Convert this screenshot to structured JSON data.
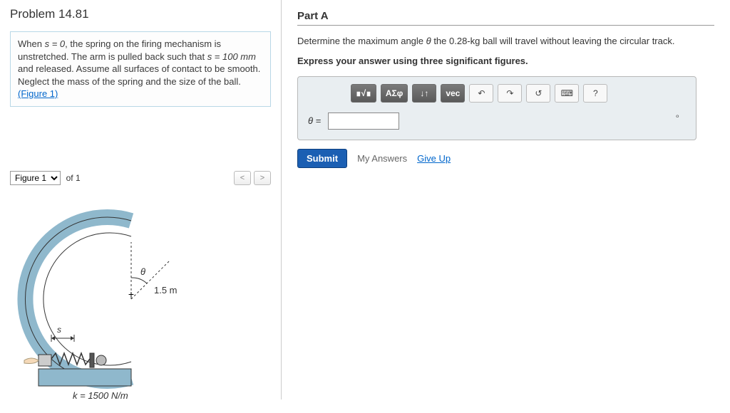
{
  "problem": {
    "number": "Problem 14.81",
    "statement_prefix": "When ",
    "statement_s0": "s = 0",
    "statement_mid1": ", the spring on the firing mechanism is unstretched. The arm is pulled back such that ",
    "statement_sval": "s = 100 mm",
    "statement_mid2": " and released. Assume all surfaces of contact to be smooth. Neglect the mass of the spring and the size of the ball.",
    "figure_link": "(Figure 1)"
  },
  "figure": {
    "selector_label": "Figure 1",
    "of_label": "of 1",
    "prev": "<",
    "next": ">",
    "radius_label": "1.5 m",
    "theta_label": "θ",
    "s_label": "s",
    "k_label": "k = 1500 N/m"
  },
  "partA": {
    "title": "Part A",
    "question_prefix": "Determine the maximum angle ",
    "question_theta": "θ",
    "question_mid": " the 0.28-",
    "question_kg": "kg",
    "question_suffix": " ball will travel without leaving the circular track.",
    "instruction": "Express your answer using three significant figures.",
    "var_label": "θ = ",
    "unit": "∘",
    "toolbar": {
      "templates": "∎√∎",
      "greek": "ΑΣφ",
      "subsup": "↓↑",
      "vec": "vec",
      "undo": "↶",
      "redo": "↷",
      "reset": "↺",
      "keyboard": "⌨",
      "help": "?"
    },
    "submit": "Submit",
    "my_answers": "My Answers",
    "give_up": "Give Up"
  }
}
